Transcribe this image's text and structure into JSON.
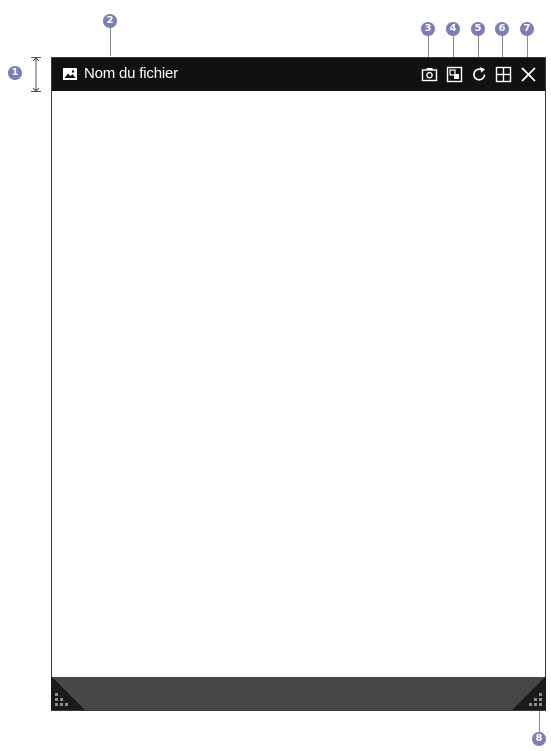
{
  "window": {
    "title": "Nom du fichier",
    "title_icon": "image-icon",
    "toolbar": [
      {
        "icon": "camera-icon",
        "callout": "3"
      },
      {
        "icon": "picture-in-picture-icon",
        "callout": "4"
      },
      {
        "icon": "rotate-icon",
        "callout": "5"
      },
      {
        "icon": "layout-grid-icon",
        "callout": "6"
      },
      {
        "icon": "close-icon",
        "callout": "7"
      }
    ],
    "resize_handles": [
      "resize-handle-bottom-left",
      "resize-handle-bottom-right"
    ]
  },
  "callouts": {
    "c1": "1",
    "c2": "2",
    "c3": "3",
    "c4": "4",
    "c5": "5",
    "c6": "6",
    "c7": "7",
    "c8": "8"
  },
  "colors": {
    "titlebar": "#111111",
    "bottombar": "#474747",
    "callout": "#7b7fb5",
    "window_border": "#3a3a3a"
  }
}
